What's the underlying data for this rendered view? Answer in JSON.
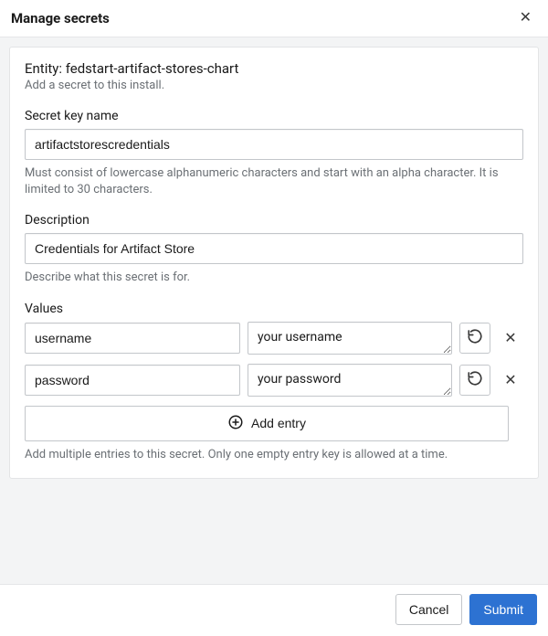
{
  "dialog": {
    "title": "Manage secrets"
  },
  "panel": {
    "entity_label_prefix": "Entity: ",
    "entity_name": "fedstart-artifact-stores-chart",
    "entity_sub": "Add a secret to this install."
  },
  "secret_key": {
    "label": "Secret key name",
    "value": "artifactstorescredentials",
    "help": "Must consist of lowercase alphanumeric characters and start with an alpha character. It is limited to 30 characters."
  },
  "description": {
    "label": "Description",
    "value": "Credentials for Artifact Store",
    "help": "Describe what this secret is for."
  },
  "values": {
    "label": "Values",
    "rows": [
      {
        "key": "username",
        "value": "your username"
      },
      {
        "key": "password",
        "value": "your password"
      }
    ],
    "add_label": "Add entry",
    "help": "Add multiple entries to this secret. Only one empty entry key is allowed at a time."
  },
  "footer": {
    "cancel": "Cancel",
    "submit": "Submit"
  }
}
